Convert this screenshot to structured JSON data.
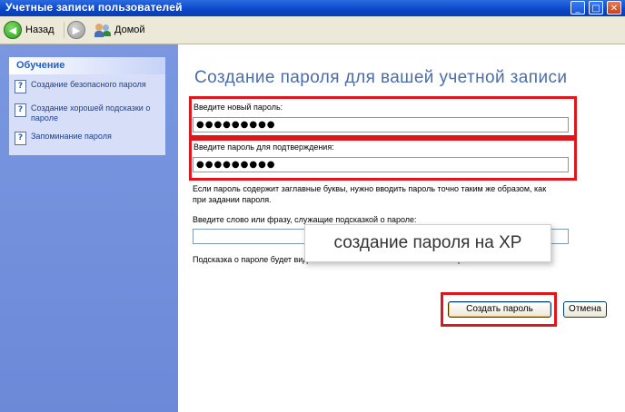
{
  "window": {
    "title": "Учетные записи пользователей"
  },
  "toolbar": {
    "back_label": "Назад",
    "home_label": "Домой"
  },
  "sidebar": {
    "header": "Обучение",
    "items": [
      {
        "label": "Создание безопасного пароля"
      },
      {
        "label": "Создание хорошей подсказки о пароле"
      },
      {
        "label": "Запоминание пароля"
      }
    ]
  },
  "main": {
    "title": "Создание пароля для вашей учетной записи",
    "new_password_label": "Введите новый пароль:",
    "new_password_value": "●●●●●●●●●",
    "confirm_label": "Введите пароль для подтверждения:",
    "confirm_value": "●●●●●●●●●",
    "case_note": "Если пароль содержит заглавные буквы, нужно вводить пароль точно таким же образом, как при задании пароля.",
    "hint_label": "Введите слово или фразу, служащие подсказкой о пароле:",
    "hint_value": "",
    "hint_note": "Подсказка о пароле будет видна всем пользователям этого компьютера.",
    "caption": "создание пароля на XP",
    "create_button": "Создать пароль",
    "cancel_button": "Отмена"
  },
  "colors": {
    "highlight": "#e0161d",
    "title_text": "#4a6ea8",
    "titlebar": "#0a46c8",
    "sidebar": "#6b89d8"
  }
}
